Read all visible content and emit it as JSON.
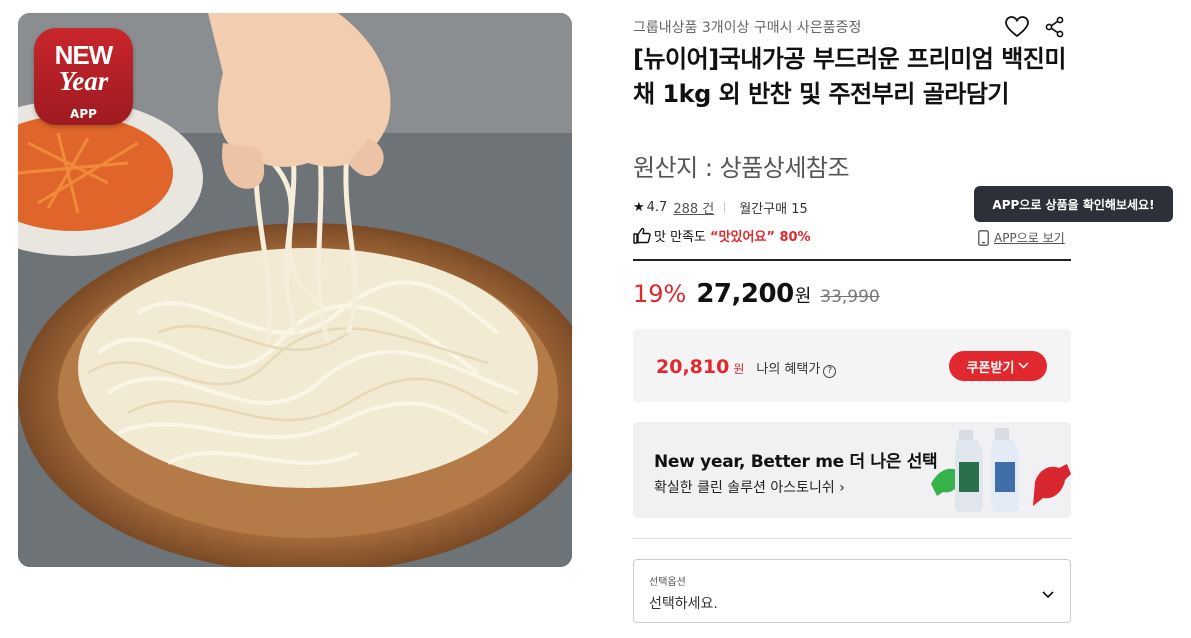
{
  "badge": {
    "line1": "NEW",
    "line2": "Year",
    "line3": "APP",
    "color": "#c8262c"
  },
  "product": {
    "promo": "그룹내상품 3개이상 구매시 사은품증정",
    "title": "[뉴이어]국내가공 부드러운 프리미엄 백진미채 1kg 외 반찬 및 주전부리 골라담기",
    "origin": "원산지 : 상품상세참조",
    "icons": {
      "wishlist": "heart-icon",
      "share": "share-icon"
    }
  },
  "rating": {
    "score": "4.7",
    "reviews": "288 건",
    "monthly": "월간구매 15"
  },
  "satisfaction": {
    "label": "맛 만족도",
    "value": "“맛있어요” 80%"
  },
  "app": {
    "tooltip": "APP으로 상품을 확인해보세요!",
    "link": "APP으로 보기"
  },
  "price": {
    "discount": "19%",
    "sale": "27,200",
    "won": "원",
    "original": "33,990",
    "accent": "#e0282e"
  },
  "benefit": {
    "price": "20,810",
    "won": "원",
    "label": "나의 혜택가",
    "help": "?",
    "coupon": "쿠폰받기"
  },
  "banner": {
    "title": "New year, Better me 더 나은 선택",
    "subtitle": "확실한 클린 솔루션 아스토니쉬 ›"
  },
  "option": {
    "label": "선택옵션",
    "value": "선택하세요."
  }
}
